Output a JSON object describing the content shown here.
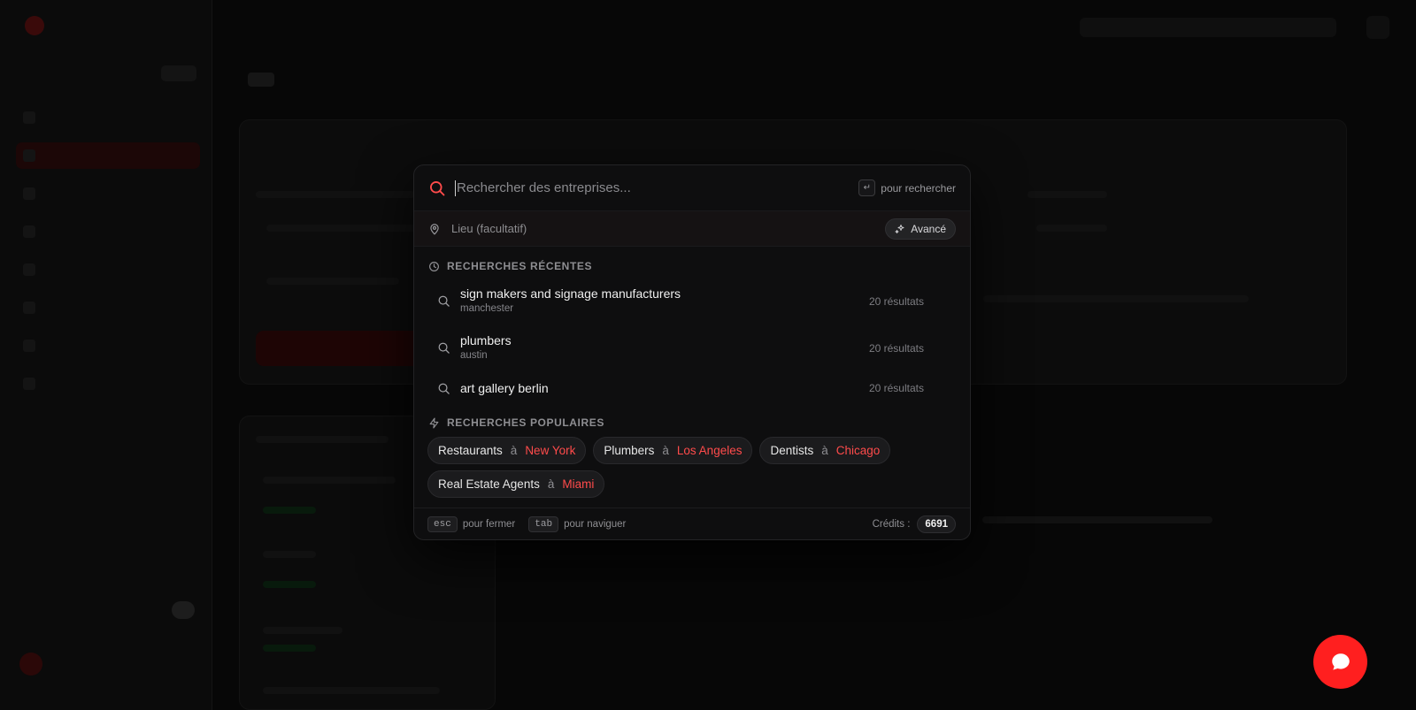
{
  "modal": {
    "search": {
      "placeholder": "Rechercher des entreprises...",
      "enter_hint": "pour rechercher",
      "enter_key_glyph": "↵"
    },
    "location": {
      "placeholder": "Lieu (facultatif)",
      "advanced_label": "Avancé"
    },
    "recent": {
      "heading": "RECHERCHES RÉCENTES",
      "items": [
        {
          "query": "sign makers and signage manufacturers",
          "location": "manchester",
          "count": "20 résultats"
        },
        {
          "query": "plumbers",
          "location": "austin",
          "count": "20 résultats"
        },
        {
          "query": "art gallery berlin",
          "location": "",
          "count": "20 résultats"
        }
      ]
    },
    "popular": {
      "heading": "RECHERCHES POPULAIRES",
      "connector": "à",
      "items": [
        {
          "category": "Restaurants",
          "city": "New York"
        },
        {
          "category": "Plumbers",
          "city": "Los Angeles"
        },
        {
          "category": "Dentists",
          "city": "Chicago"
        },
        {
          "category": "Real Estate Agents",
          "city": "Miami"
        }
      ]
    },
    "footer": {
      "esc_key": "esc",
      "esc_text": "pour fermer",
      "tab_key": "tab",
      "tab_text": "pour naviguer",
      "credits_label": "Crédits :",
      "credits_value": "6691"
    }
  },
  "colors": {
    "accent": "#ff4b4b",
    "chat_button": "#ff1f1f",
    "modal_bg": "#0e0e0f"
  },
  "icons": {
    "search": "search-icon",
    "location": "map-pin-icon",
    "advanced": "sparkles-icon",
    "recent": "clock-icon",
    "popular": "lightning-icon",
    "chat": "chat-bubble-icon"
  }
}
